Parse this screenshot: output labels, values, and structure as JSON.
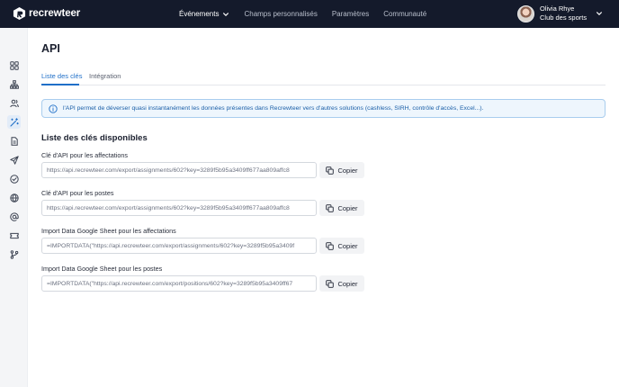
{
  "brand": {
    "name": "recrewteer"
  },
  "nav": {
    "items": [
      {
        "label": "Événements",
        "active": true,
        "has_dropdown": true
      },
      {
        "label": "Champs personnalisés",
        "active": false
      },
      {
        "label": "Paramètres",
        "active": false
      },
      {
        "label": "Communauté",
        "active": false
      }
    ]
  },
  "user": {
    "name": "Olivia Rhye",
    "club": "Club des sports"
  },
  "sidebar": {
    "icons": [
      {
        "name": "dashboard-grid-icon"
      },
      {
        "name": "org-chart-icon"
      },
      {
        "name": "users-icon"
      },
      {
        "name": "magic-wand-icon",
        "active": true
      },
      {
        "name": "document-icon"
      },
      {
        "name": "send-icon"
      },
      {
        "name": "check-circle-icon"
      },
      {
        "name": "globe-icon"
      },
      {
        "name": "at-sign-icon"
      },
      {
        "name": "ticket-icon"
      },
      {
        "name": "git-branch-icon"
      }
    ]
  },
  "page": {
    "title": "API"
  },
  "tabs": [
    {
      "label": "Liste des clés",
      "active": true
    },
    {
      "label": "Intégration",
      "active": false
    }
  ],
  "info": {
    "text": "l'API permet de déverser quasi instantanément les données présentes dans Recrewteer vers d'autres solutions (cashless, SIRH, contrôle d'accès, Excel...)."
  },
  "section": {
    "title": "Liste des clés disponibles"
  },
  "keys": [
    {
      "label": "Clé d'API pour les affectations",
      "value": "https://api.recrewteer.com/export/assignments/602?key=3289f5b95a3409ff677aa809affc8",
      "button": "Copier"
    },
    {
      "label": "Clé d'API pour les postes",
      "value": "https://api.recrewteer.com/export/assignments/602?key=3289f5b95a3409ff677aa809affc8",
      "button": "Copier"
    },
    {
      "label": "Import Data Google Sheet pour les affectations",
      "value": "=IMPORTDATA(\"https://api.recrewteer.com/export/assignments/602?key=3289f5b95a3409f",
      "button": "Copier"
    },
    {
      "label": "Import Data Google Sheet pour les postes",
      "value": "=IMPORTDATA(\"https://api.recrewteer.com/export/positions/602?key=3289f5b95a3409ff67",
      "button": "Copier"
    }
  ],
  "colors": {
    "topbar": "#141a2b",
    "accent": "#1f6fc8",
    "info_bg": "#eef6fd",
    "info_border": "#a9cdee"
  }
}
